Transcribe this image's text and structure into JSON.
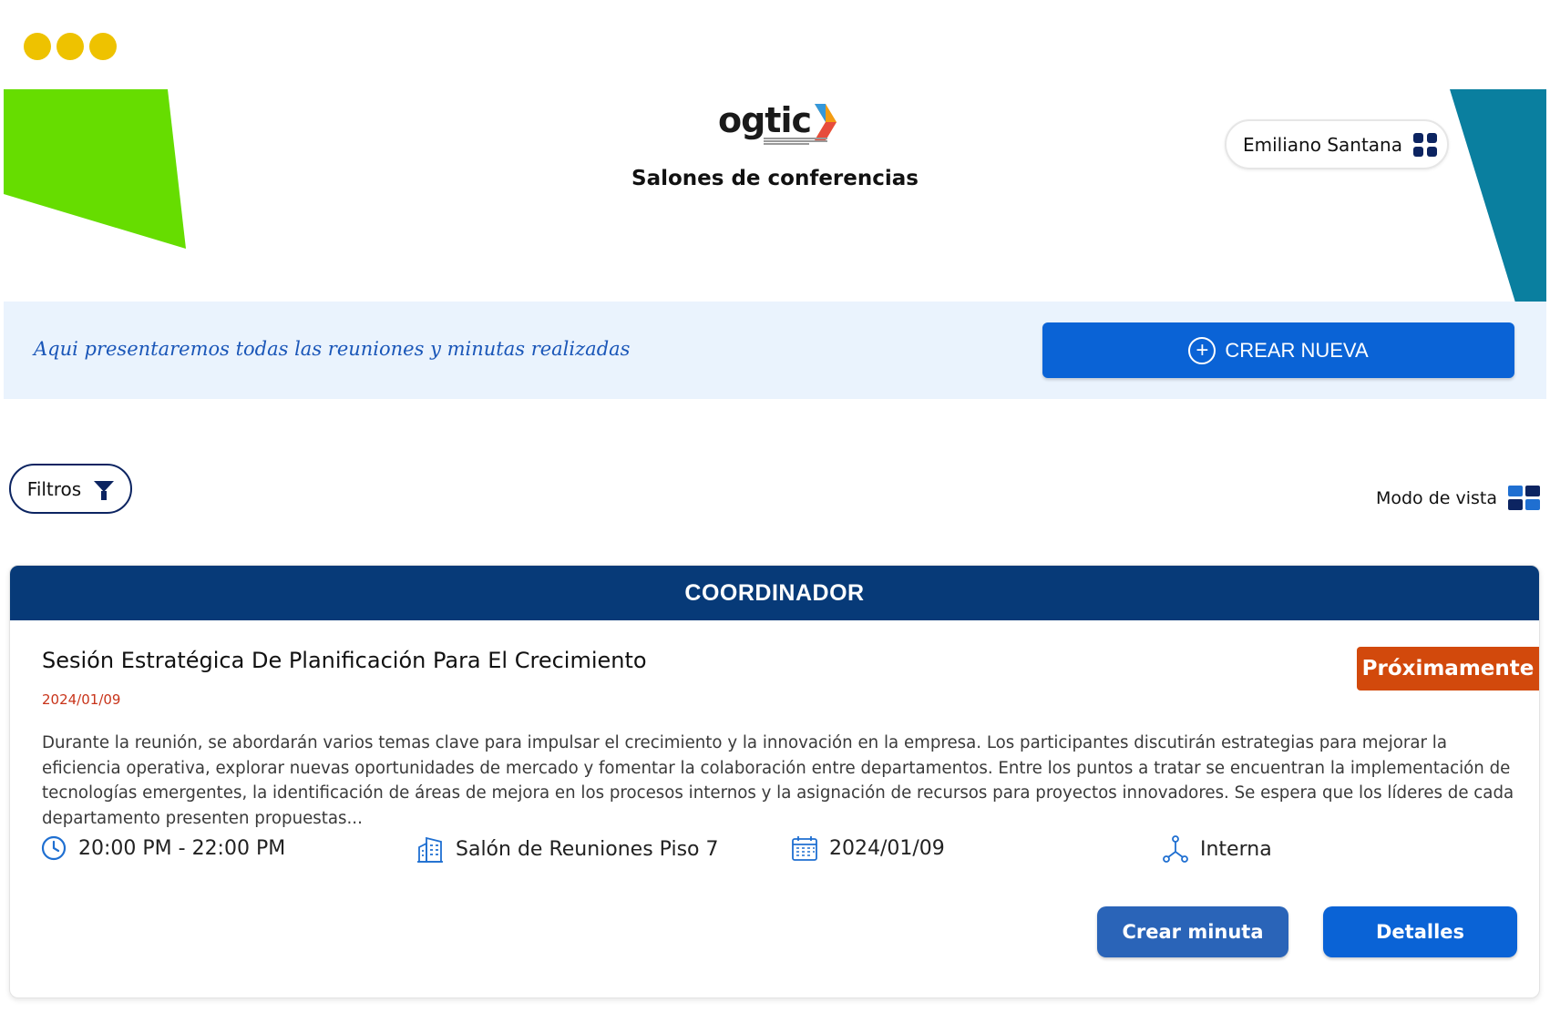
{
  "window": {
    "dots": [
      "dot",
      "dot",
      "dot"
    ]
  },
  "header": {
    "logo_text": "ogtic",
    "title": "Salones de conferencias",
    "user_name": "Emiliano Santana"
  },
  "banner": {
    "text": "Aqui presentaremos todas las reuniones y minutas realizadas",
    "create_button": "CREAR NUEVA"
  },
  "toolbar": {
    "filters_label": "Filtros",
    "view_mode_label": "Modo de vista"
  },
  "card": {
    "role": "COORDINADOR",
    "title": "Sesión Estratégica De Planificación Para El Crecimiento",
    "date": "2024/01/09",
    "status": "Próximamente",
    "description": "Durante la reunión, se abordarán varios temas clave para impulsar el crecimiento y la innovación en la empresa. Los participantes discutirán estrategias para mejorar la eficiencia operativa, explorar nuevas oportunidades de mercado y fomentar la colaboración entre departamentos. Entre los puntos a tratar se encuentran la implementación de tecnologías emergentes, la identificación de áreas de mejora en los procesos internos y la asignación de recursos para proyectos innovadores. Se espera que los líderes de cada departamento presenten propuestas...",
    "time": "20:00 PM - 22:00 PM",
    "room": "Salón de Reuniones Piso 7",
    "meeting_date": "2024/01/09",
    "type": "Interna",
    "create_minute_button": "Crear minuta",
    "details_button": "Detalles"
  },
  "colors": {
    "primary": "#0a63d6",
    "navy": "#073a78",
    "status_orange": "#d2490c",
    "green_shape": "#66dd00",
    "teal_shape": "#0a7f9f",
    "dot_yellow": "#eec200"
  },
  "icons": {
    "user_menu": "grid-icon",
    "create": "plus-circle-icon",
    "filters": "funnel-icon",
    "view_mode": "grid-view-icon",
    "time": "clock-icon",
    "room": "building-icon",
    "date": "calendar-icon",
    "type": "network-icon"
  }
}
